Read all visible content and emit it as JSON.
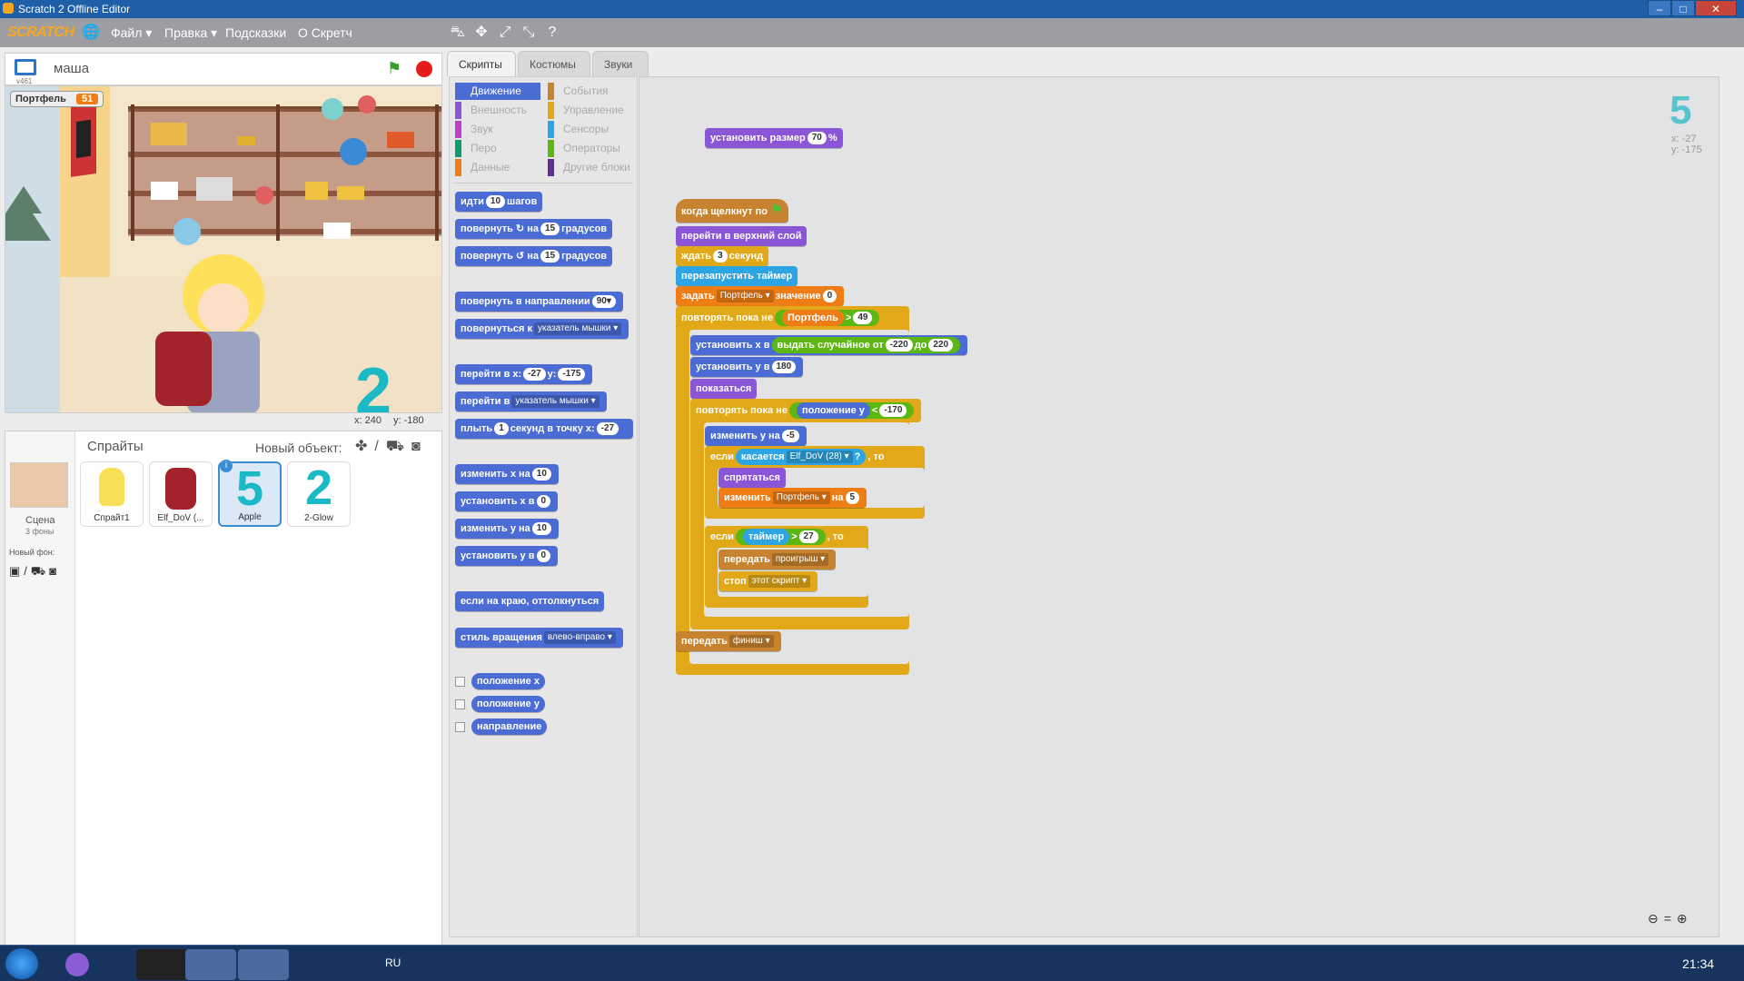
{
  "window": {
    "title": "Scratch 2 Offline Editor"
  },
  "menu": {
    "logo": "SCRATCH",
    "items": [
      "Файл ▾",
      "Правка ▾",
      "Подсказки",
      "О Скретч"
    ]
  },
  "stage": {
    "sprite_name": "маша",
    "version": "v461",
    "variable_label": "Портфель",
    "variable_value": "51",
    "coords_x": "x: 240",
    "coords_y": "y: -180",
    "shown_number": "2"
  },
  "tabs": [
    "Скрипты",
    "Костюмы",
    "Звуки"
  ],
  "categories": [
    {
      "label": "Движение",
      "color": "#4a6cd4"
    },
    {
      "label": "События",
      "color": "#c88330"
    },
    {
      "label": "Внешность",
      "color": "#8a55d7"
    },
    {
      "label": "Управление",
      "color": "#e1a91a"
    },
    {
      "label": "Звук",
      "color": "#bb42c3"
    },
    {
      "label": "Сенсоры",
      "color": "#2ca5e2"
    },
    {
      "label": "Перо",
      "color": "#0e9a6c"
    },
    {
      "label": "Операторы",
      "color": "#5cb712"
    },
    {
      "label": "Данные",
      "color": "#ee7d16"
    },
    {
      "label": "Другие блоки",
      "color": "#632d99"
    }
  ],
  "palette": {
    "move": [
      "идти",
      "10",
      "шагов"
    ],
    "turn_right": [
      "повернуть ↻ на",
      "15",
      "градусов"
    ],
    "turn_left": [
      "повернуть ↺ на",
      "15",
      "градусов"
    ],
    "point_dir": [
      "повернуть в направлении",
      "90▾"
    ],
    "point_towards": [
      "повернуться к",
      "указатель мышки ▾"
    ],
    "goto_xy": [
      "перейти в x:",
      "-27",
      "y:",
      "-175"
    ],
    "goto": [
      "перейти в",
      "указатель мышки ▾"
    ],
    "glide": [
      "плыть",
      "1",
      "секунд в точку x:",
      "-27"
    ],
    "change_x": [
      "изменить х на",
      "10"
    ],
    "set_x": [
      "установить х в",
      "0"
    ],
    "change_y": [
      "изменить у на",
      "10"
    ],
    "set_y": [
      "установить у в",
      "0"
    ],
    "bounce": "если на краю, оттолкнуться",
    "rot_style": [
      "стиль вращения",
      "влево-вправо ▾"
    ],
    "reporters": [
      "положение x",
      "положение y",
      "направление"
    ]
  },
  "sprites": {
    "header": "Спрайты",
    "new_object": "Новый объект:",
    "stage_label": "Сцена",
    "stage_sub": "3 фоны",
    "new_backdrop": "Новый фон:",
    "list": [
      "Спрайт1",
      "Elf_DoV (...",
      "Apple",
      "2-Glow"
    ]
  },
  "script_info": {
    "x": "x: -27",
    "y": "y: -175",
    "sprite_glyph": "5"
  },
  "scripts": {
    "set_size": [
      "установить размер",
      "70",
      "%"
    ],
    "hat": "когда щелкнут по",
    "front": "перейти в верхний слой",
    "wait": [
      "ждать",
      "3",
      "секунд"
    ],
    "reset_timer": "перезапустить таймер",
    "set_var": [
      "задать",
      "Портфель ▾",
      "значение",
      "0"
    ],
    "repeat_until": [
      "повторять пока не",
      "Портфель",
      ">",
      "49"
    ],
    "set_x_rand": [
      "установить х в",
      "выдать случайное от",
      "-220",
      "до",
      "220"
    ],
    "set_y": [
      "установить у в",
      "180"
    ],
    "show": "показаться",
    "repeat_until2": [
      "повторять пока не",
      "положение у",
      "<",
      "-170"
    ],
    "change_y": [
      "изменить у на",
      "-5"
    ],
    "if_touch": [
      "если",
      "касается",
      "Elf_DoV (28) ▾",
      "?",
      ", то"
    ],
    "hide": "спрятаться",
    "change_var": [
      "изменить",
      "Портфель ▾",
      "на",
      "5"
    ],
    "if_timer": [
      "если",
      "таймер",
      ">",
      "27",
      ", то"
    ],
    "broadcast_lose": [
      "передать",
      "проигрыш ▾"
    ],
    "stop": [
      "стоп",
      "этот скрипт ▾"
    ],
    "broadcast_finish": [
      "передать",
      "финиш ▾"
    ]
  },
  "taskbar": {
    "lang": "RU",
    "time": "21:34"
  }
}
